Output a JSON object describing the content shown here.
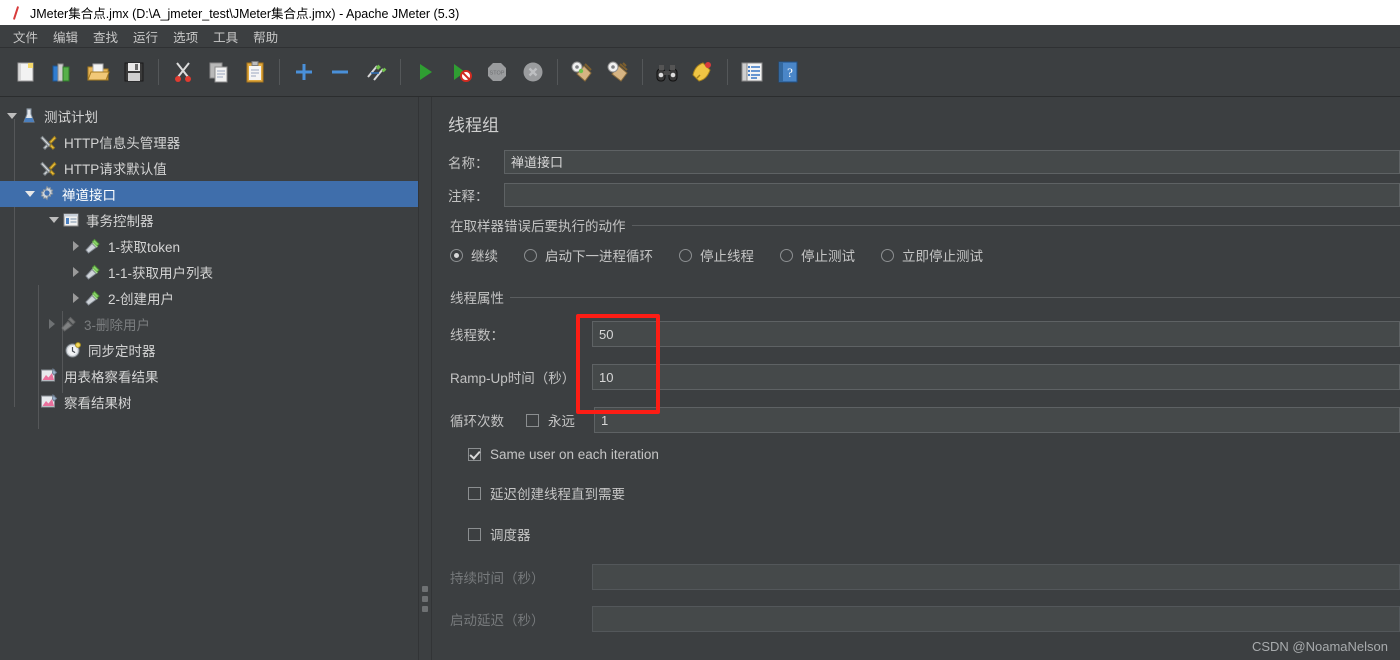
{
  "window": {
    "title": "JMeter集合点.jmx (D:\\A_jmeter_test\\JMeter集合点.jmx) - Apache JMeter (5.3)",
    "app_icon": "jmeter-feather-icon"
  },
  "menubar": {
    "items": [
      {
        "label": "文件",
        "name": "menu-file"
      },
      {
        "label": "编辑",
        "name": "menu-edit"
      },
      {
        "label": "查找",
        "name": "menu-search"
      },
      {
        "label": "运行",
        "name": "menu-run"
      },
      {
        "label": "选项",
        "name": "menu-options"
      },
      {
        "label": "工具",
        "name": "menu-tools"
      },
      {
        "label": "帮助",
        "name": "menu-help"
      }
    ]
  },
  "toolbar": {
    "buttons": [
      {
        "name": "new-button",
        "icon": "new-document-icon"
      },
      {
        "name": "templates-button",
        "icon": "templates-books-icon"
      },
      {
        "name": "open-button",
        "icon": "open-folder-icon"
      },
      {
        "name": "save-button",
        "icon": "save-floppy-icon"
      },
      {
        "separator_after": false
      }
    ],
    "groups": [
      [
        "new-document-icon",
        "templates-books-icon",
        "open-folder-icon",
        "save-floppy-icon"
      ],
      [
        "cut-scissors-icon",
        "copy-icon",
        "paste-clipboard-icon"
      ],
      [
        "expand-plus-icon",
        "collapse-minus-icon",
        "toggle-enable-icon"
      ],
      [
        "start-play-icon",
        "start-no-pauses-icon",
        "stop-icon",
        "shutdown-icon"
      ],
      [
        "clear-icon",
        "clear-all-icon"
      ],
      [
        "search-binoculars-icon",
        "reset-search-icon"
      ],
      [
        "function-helper-icon",
        "help-book-icon"
      ]
    ]
  },
  "tree": {
    "nodes": [
      {
        "label": "测试计划",
        "icon": "test-plan-icon",
        "indent": 0,
        "toggle": "expanded",
        "state": "normal",
        "name": "tree-node-test-plan"
      },
      {
        "label": "HTTP信息头管理器",
        "icon": "header-manager-icon",
        "indent": 1,
        "toggle": "none",
        "state": "normal",
        "name": "tree-node-http-header-manager"
      },
      {
        "label": "HTTP请求默认值",
        "icon": "http-defaults-icon",
        "indent": 1,
        "toggle": "none",
        "state": "normal",
        "name": "tree-node-http-defaults"
      },
      {
        "label": "禅道接口",
        "icon": "thread-group-icon",
        "indent": 1,
        "toggle": "expanded",
        "state": "selected",
        "name": "tree-node-thread-group"
      },
      {
        "label": "事务控制器",
        "icon": "transaction-controller-icon",
        "indent": 2,
        "toggle": "expanded",
        "state": "normal",
        "name": "tree-node-transaction-controller"
      },
      {
        "label": "1-获取token",
        "icon": "http-sampler-icon",
        "indent": 3,
        "toggle": "collapsed",
        "state": "normal",
        "name": "tree-node-sampler-get-token"
      },
      {
        "label": "1-1-获取用户列表",
        "icon": "http-sampler-icon",
        "indent": 3,
        "toggle": "collapsed",
        "state": "normal",
        "name": "tree-node-sampler-get-user-list"
      },
      {
        "label": "2-创建用户",
        "icon": "http-sampler-icon",
        "indent": 3,
        "toggle": "collapsed",
        "state": "normal",
        "name": "tree-node-sampler-create-user"
      },
      {
        "label": "3-删除用户",
        "icon": "http-sampler-disabled-icon",
        "indent": 2,
        "toggle": "collapsed",
        "state": "disabled",
        "name": "tree-node-sampler-delete-user"
      },
      {
        "label": "同步定时器",
        "icon": "synchronizing-timer-icon",
        "indent": 2,
        "toggle": "none",
        "state": "normal",
        "name": "tree-node-synchronizing-timer"
      },
      {
        "label": "用表格察看结果",
        "icon": "view-results-table-icon",
        "indent": 1,
        "toggle": "none",
        "state": "normal",
        "name": "tree-node-view-results-in-table"
      },
      {
        "label": "察看结果树",
        "icon": "view-results-tree-icon",
        "indent": 1,
        "toggle": "none",
        "state": "normal",
        "name": "tree-node-view-results-tree"
      }
    ]
  },
  "main": {
    "panel_title": "线程组",
    "name_label": "名称：",
    "name_value": "禅道接口",
    "comment_label": "注释：",
    "comment_value": "",
    "on_error_group": {
      "legend": "在取样器错误后要执行的动作",
      "options": [
        {
          "label": "继续",
          "selected": true,
          "name": "radio-continue"
        },
        {
          "label": "启动下一进程循环",
          "selected": false,
          "name": "radio-start-next-thread-loop"
        },
        {
          "label": "停止线程",
          "selected": false,
          "name": "radio-stop-thread"
        },
        {
          "label": "停止测试",
          "selected": false,
          "name": "radio-stop-test"
        },
        {
          "label": "立即停止测试",
          "selected": false,
          "name": "radio-stop-test-now"
        }
      ]
    },
    "thread_properties": {
      "legend": "线程属性",
      "num_threads_label": "线程数：",
      "num_threads_value": "50",
      "ramp_up_label": "Ramp-Up时间（秒）",
      "ramp_up_value": "10",
      "loop_count_label": "循环次数",
      "forever_label": "永远",
      "forever_checked": false,
      "loop_count_value": "1",
      "same_user_label": "Same user on each iteration",
      "same_user_checked": true,
      "delay_create_label": "延迟创建线程直到需要",
      "delay_create_checked": false,
      "scheduler_label": "调度器",
      "scheduler_checked": false,
      "duration_label": "持续时间（秒）",
      "duration_value": "",
      "startup_delay_label": "启动延迟（秒）",
      "startup_delay_value": ""
    }
  },
  "annotation": {
    "highlight_color": "#fc1d15",
    "highlight_name": "red-highlight-box"
  },
  "watermark": {
    "text": "CSDN @NoamaNelson"
  },
  "colors": {
    "window_bg": "#3c3f41",
    "titlebar_bg": "#ffffff",
    "selection_blue": "#3f6eab",
    "field_bg": "#45494a",
    "text": "#c2c2c2",
    "disabled_text": "#76797b"
  }
}
